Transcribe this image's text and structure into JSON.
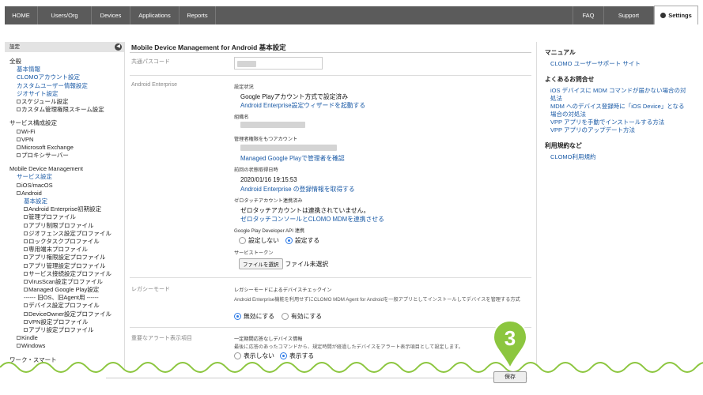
{
  "nav": {
    "home": "HOME",
    "users": "Users/Org",
    "devices": "Devices",
    "applications": "Applications",
    "reports": "Reports",
    "faq": "FAQ",
    "support": "Support",
    "settings": "Settings"
  },
  "sidebar": {
    "header": "設定",
    "rows": [
      {
        "text": "全般",
        "type": "plain"
      },
      {
        "text": "基本情報",
        "type": "link1"
      },
      {
        "text": "CLOMOアカウント設定",
        "type": "link1"
      },
      {
        "text": "カスタムユーザー情報設定",
        "type": "link1"
      },
      {
        "text": "ジオサイト設定",
        "type": "link1"
      },
      {
        "text": "スケジュール設定",
        "type": "box1"
      },
      {
        "text": "カスタム管理権限スキーム設定",
        "type": "box1"
      },
      {
        "gap": true
      },
      {
        "text": "サービス構成設定",
        "type": "plain"
      },
      {
        "text": "Wi-Fi",
        "type": "box1"
      },
      {
        "text": "VPN",
        "type": "box1"
      },
      {
        "text": "Microsoft Exchange",
        "type": "box1"
      },
      {
        "text": "プロキシサーバー",
        "type": "box1"
      },
      {
        "gap": true
      },
      {
        "text": "Mobile Device Management",
        "type": "plain"
      },
      {
        "text": "サービス設定",
        "type": "link1"
      },
      {
        "text": "iOS/macOS",
        "type": "box1"
      },
      {
        "text": "Android",
        "type": "box1"
      },
      {
        "text": "基本設定",
        "type": "link2"
      },
      {
        "text": "Android Enterprise初期設定",
        "type": "box2"
      },
      {
        "text": "管理プロファイル",
        "type": "box2"
      },
      {
        "text": "アプリ制限プロファイル",
        "type": "box2"
      },
      {
        "text": "ジオフェンス設定プロファイル",
        "type": "box2"
      },
      {
        "text": "ロックタスクプロファイル",
        "type": "box2"
      },
      {
        "text": "専用端末プロファイル",
        "type": "box2"
      },
      {
        "text": "アプリ権限設定プロファイル",
        "type": "box2"
      },
      {
        "text": "アプリ管理設定プロファイル",
        "type": "box2"
      },
      {
        "text": "サービス接続設定プロファイル",
        "type": "box2"
      },
      {
        "text": "VirusScan設定プロファイル",
        "type": "box2"
      },
      {
        "text": "Managed Google Play設定",
        "type": "box2"
      },
      {
        "text": "------ 旧OS、旧Agent用 ------",
        "type": "text2"
      },
      {
        "text": "デバイス設定プロファイル",
        "type": "box2"
      },
      {
        "text": "DeviceOwner設定プロファイル",
        "type": "box2"
      },
      {
        "text": "VPN設定プロファイル",
        "type": "box2"
      },
      {
        "text": "アプリ設定プロファイル",
        "type": "box2"
      },
      {
        "text": "Kindle",
        "type": "box1"
      },
      {
        "text": "Windows",
        "type": "box1"
      },
      {
        "gap": true
      },
      {
        "text": "ワーク・スマート",
        "type": "plain"
      }
    ]
  },
  "main": {
    "title": "Mobile Device Management for Android 基本設定",
    "passcode_label": "共通パスコード",
    "ae_label": "Android Enterprise",
    "setup_status_label": "設定状況",
    "setup_status_value": "Google Playアカウント方式で設定済み",
    "setup_wizard_link": "Android Enterprise設定ウィザードを起動する",
    "org_name_label": "組織名",
    "admin_label": "管理者権限をもつアカウント",
    "admin_link": "Managed Google Playで管理者を確認",
    "last_fetch_label": "前回の状態取得日時",
    "last_fetch_value": "2020/01/16 19:15:53",
    "fetch_link": "Android Enterprise の登録情報を取得する",
    "zerotouch_label": "ゼロタッチアカウント連携済み",
    "zerotouch_value": "ゼロタッチアカウントは連携されていません。",
    "zerotouch_link": "ゼロタッチコンソールとCLOMO MDMを連携させる",
    "api_label": "Google Play Developer API 連携",
    "api_no": "設定しない",
    "api_yes": "設定する",
    "service_token_label": "サービストークン",
    "file_button": "ファイルを選択",
    "file_status": "ファイル未選択",
    "legacy_label": "レガシーモード",
    "legacy_check_label": "レガシーモードによるデバイスチェックイン",
    "legacy_desc": "Android Enterprise機能を利用せずにCLOMO MDM Agent for Androidを一般アプリとしてインストールしてデバイスを管理する方式",
    "legacy_off": "無効にする",
    "legacy_on": "有効にする",
    "alert_label": "重要なアラート表示項目",
    "alert_title": "一定期間応答なしデバイス情報",
    "alert_desc": "最後に応答のあったコマンドから、規定時間が経過したデバイスをアラート表示項目として設定します。",
    "alert_hide": "表示しない",
    "alert_show": "表示する",
    "save": "保存"
  },
  "right": {
    "manual_head": "マニュアル",
    "manual_link": "CLOMO ユーザーサポート サイト",
    "faq_head": "よくあるお問合せ",
    "faq_links": [
      "iOS デバイスに MDM コマンドが届かない場合の対",
      "処法",
      "MDM へのデバイス登録時に「iOS Device」となる",
      "場合の対処法",
      "VPP アプリを手動でインストールする方法",
      "VPP アプリのアップデート方法"
    ],
    "terms_head": "利用規約など",
    "terms_link": "CLOMO利用規約"
  },
  "callout": {
    "number": "3",
    "color": "#8cc63f"
  },
  "colors": {
    "link": "#1a5aa6",
    "nav": "#5b5b5b",
    "wave": "#8cc63f",
    "radio": "#2e7be6"
  }
}
